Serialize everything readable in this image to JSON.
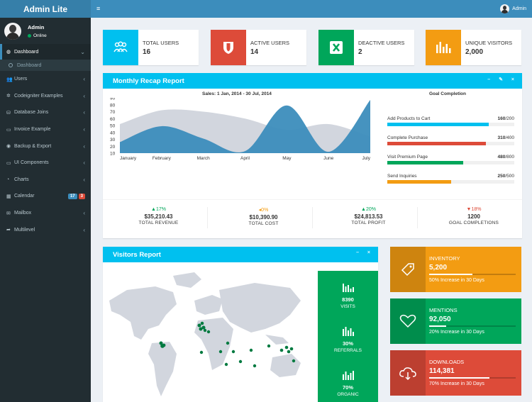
{
  "app": {
    "logo": "Admin Lite"
  },
  "user": {
    "name": "Admin",
    "status": "Online"
  },
  "topbar": {
    "menu_icon": "≡",
    "user_name": "Admin"
  },
  "sidebar": {
    "items": [
      {
        "label": "Dashboard",
        "icon": "dashboard-icon",
        "glyph": "◍",
        "chevron": "⌄"
      },
      {
        "label": "Users",
        "icon": "users-icon",
        "glyph": "👥",
        "chevron": "‹"
      },
      {
        "label": "Codeigniter Examples",
        "icon": "gear-icon",
        "glyph": "✲",
        "chevron": "‹"
      },
      {
        "label": "Database Joins",
        "icon": "database-icon",
        "glyph": "⛁",
        "chevron": "‹"
      },
      {
        "label": "Invoice Example",
        "icon": "invoice-icon",
        "glyph": "▭",
        "chevron": "‹"
      },
      {
        "label": "Backup & Export",
        "icon": "globe-icon",
        "glyph": "◉",
        "chevron": "‹"
      },
      {
        "label": "UI Components",
        "icon": "laptop-icon",
        "glyph": "▭",
        "chevron": "‹"
      },
      {
        "label": "Charts",
        "icon": "pie-chart-icon",
        "glyph": "◔",
        "chevron": "‹"
      },
      {
        "label": "Calendar",
        "icon": "calendar-icon",
        "glyph": "▦",
        "badges": [
          "17",
          "3"
        ]
      },
      {
        "label": "Mailbox",
        "icon": "envelope-icon",
        "glyph": "✉",
        "chevron": "‹"
      },
      {
        "label": "Multilevel",
        "icon": "share-icon",
        "glyph": "➦",
        "chevron": "‹"
      }
    ],
    "submenu": {
      "label": "Dashboard"
    }
  },
  "info_boxes": [
    {
      "label": "TOTAL USERS",
      "value": "16",
      "color": "#00c0ef",
      "icon": "users-group-icon"
    },
    {
      "label": "ACTIVE USERS",
      "value": "14",
      "color": "#dd4b39",
      "icon": "shield-icon"
    },
    {
      "label": "DEACTIVE USERS",
      "value": "2",
      "color": "#00a65a",
      "icon": "excel-icon"
    },
    {
      "label": "UNIQUE VISITORS",
      "value": "2,000",
      "color": "#f39c12",
      "icon": "bar-chart-icon"
    }
  ],
  "recap": {
    "title": "Monthly Recap Report",
    "tools": "– ✎ ×",
    "chart_title": "Sales: 1 Jan, 2014 - 30 Jul, 2014",
    "goal_title": "Goal Completion",
    "goals": [
      {
        "label": "Add Products to Cart",
        "done": "160",
        "total": "/200",
        "pct": 80,
        "color": "#00c0ef"
      },
      {
        "label": "Complete Purchase",
        "done": "310",
        "total": "/400",
        "pct": 77.5,
        "color": "#dd4b39"
      },
      {
        "label": "Visit Premium Page",
        "done": "480",
        "total": "/800",
        "pct": 60,
        "color": "#00a65a"
      },
      {
        "label": "Send Inquiries",
        "done": "250",
        "total": "/500",
        "pct": 50,
        "color": "#f39c12"
      }
    ],
    "footer": [
      {
        "pct": "▲17%",
        "pct_color": "#00a65a",
        "amount": "$35,210.43",
        "label": "TOTAL REVENUE"
      },
      {
        "pct": "◂0%",
        "pct_color": "#f39c12",
        "amount": "$10,390.90",
        "label": "TOTAL COST"
      },
      {
        "pct": "▲20%",
        "pct_color": "#00a65a",
        "amount": "$24,813.53",
        "label": "TOTAL PROFIT"
      },
      {
        "pct": "▼18%",
        "pct_color": "#dd4b39",
        "amount": "1200",
        "label": "GOAL COMPLETIONS"
      }
    ]
  },
  "chart_data": {
    "type": "area",
    "title": "Sales: 1 Jan, 2014 - 30 Jul, 2014",
    "categories": [
      "January",
      "February",
      "March",
      "April",
      "May",
      "June",
      "July"
    ],
    "y_ticks": [
      "90",
      "80",
      "70",
      "60",
      "50",
      "40",
      "30",
      "20",
      "10"
    ],
    "ylim": [
      10,
      90
    ],
    "series": [
      {
        "values": [
          52,
          72,
          70,
          60,
          44,
          52,
          34
        ],
        "color": "#d2d6de"
      },
      {
        "values": [
          26,
          49,
          31,
          13,
          79,
          12,
          87
        ],
        "color": "#3c8dbc"
      }
    ]
  },
  "visitors": {
    "title": "Visitors Report",
    "tools": "– ×",
    "stats": [
      {
        "value": "8390",
        "label": "VISITS"
      },
      {
        "value": "30%",
        "label": "REFERRALS"
      },
      {
        "value": "70%",
        "label": "ORGANIC"
      }
    ]
  },
  "small_boxes": [
    {
      "name": "INVENTORY",
      "value": "5,200",
      "desc": "50% Increase in 30 Days",
      "pct": 50,
      "color": "#f39c12",
      "icon": "tag-icon"
    },
    {
      "name": "MENTIONS",
      "value": "92,050",
      "desc": "20% Increase in 30 Days",
      "pct": 20,
      "color": "#00a65a",
      "icon": "heart-icon"
    },
    {
      "name": "DOWNLOADS",
      "value": "114,381",
      "desc": "70% Increase in 30 Days",
      "pct": 70,
      "color": "#dd4b39",
      "icon": "cloud-download-icon"
    }
  ]
}
